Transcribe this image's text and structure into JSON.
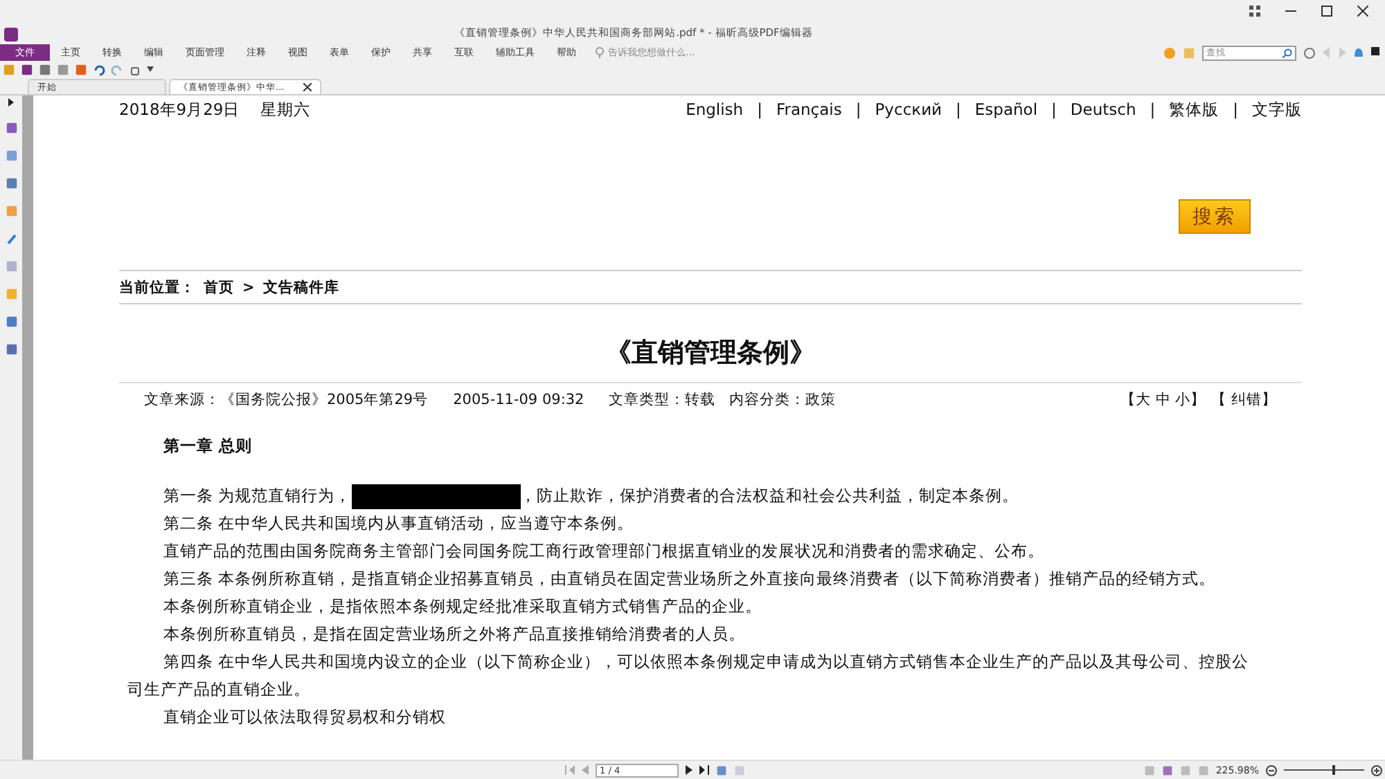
{
  "window": {
    "title": "《直销管理条例》中华人民共和国商务部网站.pdf * - 福昕高级PDF编辑器"
  },
  "menu": [
    {
      "label": "文件",
      "selected": true
    },
    {
      "label": "主页",
      "selected": false
    },
    {
      "label": "转换",
      "selected": false
    },
    {
      "label": "编辑",
      "selected": false
    },
    {
      "label": "页面管理",
      "selected": false
    },
    {
      "label": "注释",
      "selected": false
    },
    {
      "label": "视图",
      "selected": false
    },
    {
      "label": "表单",
      "selected": false
    },
    {
      "label": "保护",
      "selected": false
    },
    {
      "label": "共享",
      "selected": false
    },
    {
      "label": "互联",
      "selected": false
    },
    {
      "label": "辅助工具",
      "selected": false
    },
    {
      "label": "帮助",
      "selected": false
    }
  ],
  "tell_me": {
    "placeholder": "告诉我您想做什么..."
  },
  "search": {
    "placeholder": "查找"
  },
  "doc_tabs": [
    {
      "label": "开始",
      "selected": false,
      "closable": false
    },
    {
      "label": "《直销管理条例》中华...",
      "selected": true,
      "closable": true
    }
  ],
  "page": {
    "date": "2018年9月29日",
    "weekday": "星期六",
    "languages": [
      "English",
      "Français",
      "Русский",
      "Español",
      "Deutsch",
      "繁体版",
      "文字版"
    ],
    "separator": "|",
    "search_button": "搜索",
    "breadcrumb": {
      "label": "当前位置：",
      "home": "首页",
      "arrow": ">",
      "current": "文告稿件库"
    },
    "title": "《直销管理条例》",
    "meta": {
      "source": "文章来源：《国务院公报》2005年第29号",
      "datetime": "2005-11-09 09:32",
      "type": "文章类型：转载",
      "category": "内容分类：政策",
      "font_size": "【大 中 小】",
      "correct": "【 纠错】"
    },
    "chapter": "第一章 总则",
    "paragraphs": [
      {
        "kind": "redacted",
        "before": "第一条 为规范直销行为，",
        "after": "，防止欺诈，保护消费者的合法权益和社会公共利益，制定本条例。"
      },
      {
        "kind": "text",
        "text": "第二条 在中华人民共和国境内从事直销活动，应当遵守本条例。"
      },
      {
        "kind": "text",
        "text": "直销产品的范围由国务院商务主管部门会同国务院工商行政管理部门根据直销业的发展状况和消费者的需求确定、公布。"
      },
      {
        "kind": "text",
        "text": "第三条 本条例所称直销，是指直销企业招募直销员，由直销员在固定营业场所之外直接向最终消费者（以下简称消费者）推销产品的经销方式。"
      },
      {
        "kind": "text",
        "text": "本条例所称直销企业，是指依照本条例规定经批准采取直销方式销售产品的企业。"
      },
      {
        "kind": "text",
        "text": "本条例所称直销员，是指在固定营业场所之外将产品直接推销给消费者的人员。"
      },
      {
        "kind": "text",
        "text": "第四条 在中华人民共和国境内设立的企业（以下简称企业），可以依照本条例规定申请成为以直销方式销售本企业生产的产品以及其母公司、控股公"
      },
      {
        "kind": "wrap",
        "text": "司生产产品的直销企业。"
      },
      {
        "kind": "text",
        "text": "直销企业可以依法取得贸易权和分销权"
      }
    ]
  },
  "status_bar": {
    "page": "1 / 4",
    "zoom": "225.98%",
    "zoom_slider": {
      "level": 0.6
    }
  }
}
